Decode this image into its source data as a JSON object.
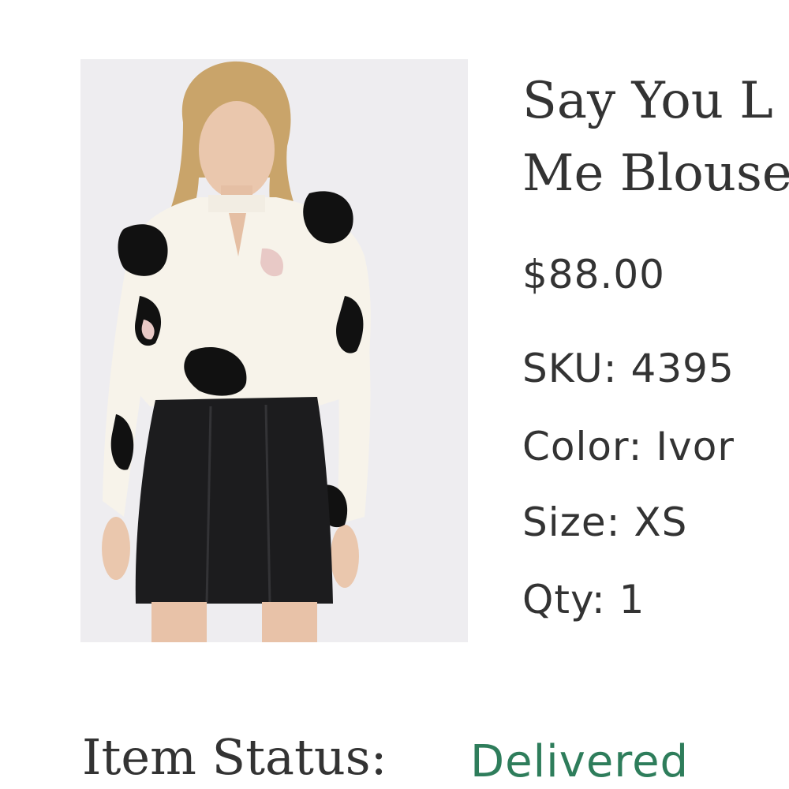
{
  "product": {
    "title_line1": "Say You L",
    "title_line2": "Me Blouse",
    "price": "$88.00",
    "sku_label": "SKU:",
    "sku_value": "4395",
    "color_label": "Color:",
    "color_value": "Ivor",
    "size_label": "Size:",
    "size_value": "XS",
    "qty_label": "Qty:",
    "qty_value": "1"
  },
  "status": {
    "label": "Item Status:",
    "value": "Delivered",
    "value_color": "#2e7d5b"
  },
  "colors": {
    "text": "#333333",
    "photo_background": "#eeedf0"
  }
}
